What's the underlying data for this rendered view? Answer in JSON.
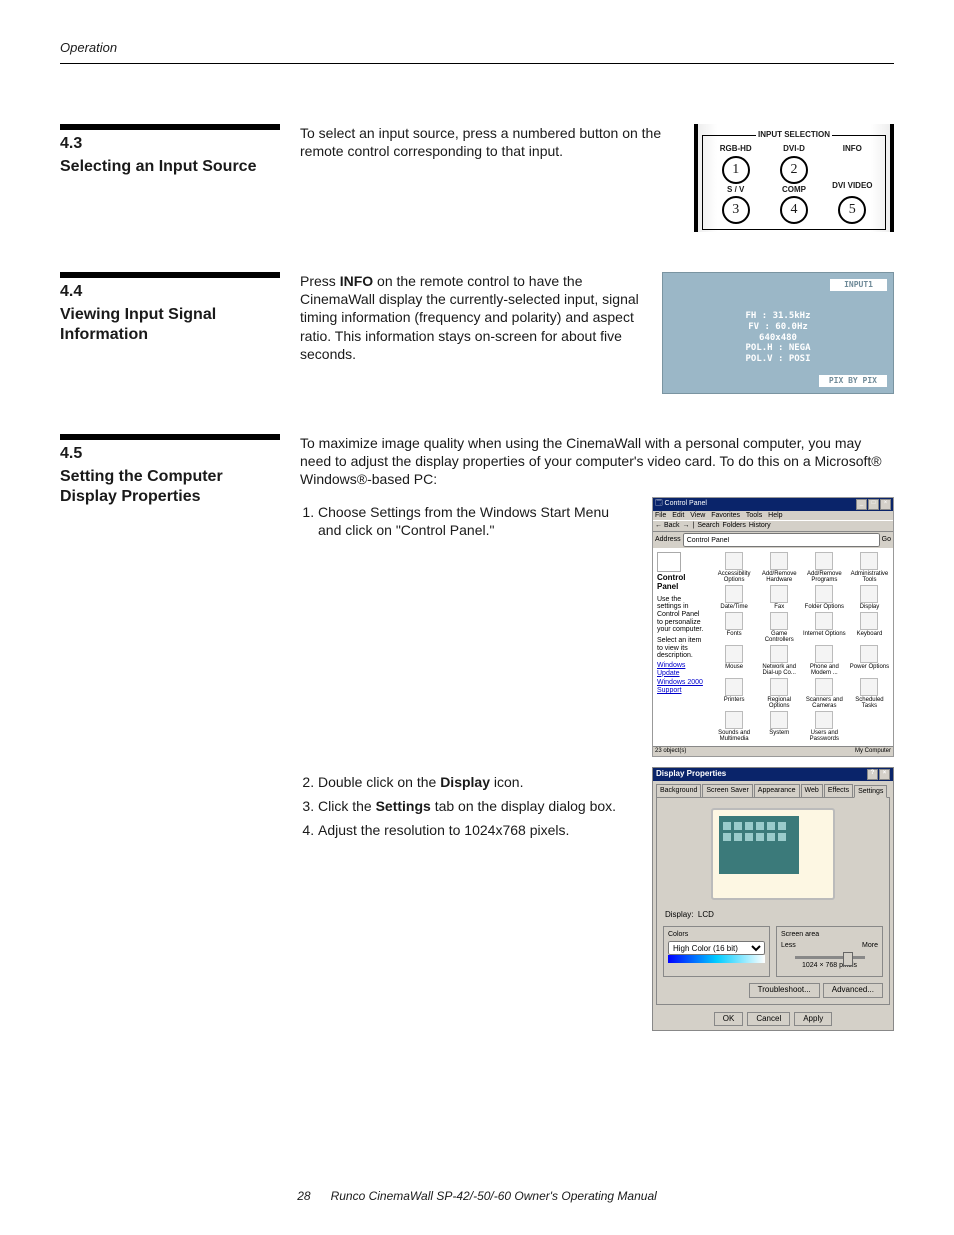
{
  "running_head": "Operation",
  "sections": {
    "s43": {
      "num": "4.3",
      "title": "Selecting an Input Source",
      "body": "To select an input source, press a numbered button on the remote control corresponding to that input."
    },
    "s44": {
      "num": "4.4",
      "title": "Viewing Input Signal Information",
      "body_pre": "Press ",
      "body_bold": "INFO",
      "body_post": " on the remote control to have the CinemaWall display the currently-selected input, signal timing information (frequency and polarity) and aspect ratio. This information stays on-screen for about five seconds."
    },
    "s45": {
      "num": "4.5",
      "title": "Setting the Computer Display Properties",
      "intro": "To maximize image quality when using the CinemaWall with a personal computer, you may need to adjust the display properties of your computer's video card. To do this on a Microsoft® Windows®-based PC:",
      "step1": "Choose Settings from the Windows Start Menu and click on \"Control Panel.\"",
      "step2_pre": "Double click on the ",
      "step2_bold": "Display",
      "step2_post": " icon.",
      "step3_pre": "Click the ",
      "step3_bold": "Settings",
      "step3_post": " tab on the display dialog box.",
      "step4": "Adjust the resolution to 1024x768 pixels."
    }
  },
  "remote": {
    "legend": "INPUT SELECTION",
    "cells": {
      "rgb": "RGB-HD",
      "dvi": "DVI-D",
      "info": "INFO",
      "sv": "S / V",
      "comp": "COMP",
      "dvivid": "DVI VIDEO",
      "b1": "1",
      "b2": "2",
      "b3": "3",
      "b4": "4",
      "b5": "5"
    }
  },
  "osd": {
    "input": "INPUT1",
    "l1": "FH : 31.5kHz",
    "l2": "FV : 60.0Hz",
    "l3": "640x480",
    "l4": "POL.H : NEGA",
    "l5": "POL.V : POSI",
    "bottom": "PIX BY PIX"
  },
  "cp": {
    "title": "Control Panel",
    "menu": [
      "File",
      "Edit",
      "View",
      "Favorites",
      "Tools",
      "Help"
    ],
    "tool": [
      "← Back",
      "→",
      "Search",
      "Folders",
      "History"
    ],
    "addr_label": "Address",
    "addr_val": "Control Panel",
    "go": "Go",
    "left_title": "Control Panel",
    "left_txt": "Use the settings in Control Panel to personalize your computer.",
    "left_txt2": "Select an item to view its description.",
    "links": [
      "Windows Update",
      "Windows 2000 Support"
    ],
    "icons": [
      "Accessibility Options",
      "Add/Remove Hardware",
      "Add/Remove Programs",
      "Administrative Tools",
      "Date/Time",
      "Fax",
      "Folder Options",
      "Display",
      "Fonts",
      "Game Controllers",
      "Internet Options",
      "Keyboard",
      "Mouse",
      "Network and Dial-up Co...",
      "Phone and Modem ...",
      "Power Options",
      "Printers",
      "Regional Options",
      "Scanners and Cameras",
      "Scheduled Tasks",
      "Sounds and Multimedia",
      "System",
      "Users and Passwords"
    ],
    "status_l": "23 object(s)",
    "status_r": "My Computer"
  },
  "dp": {
    "title": "Display Properties",
    "tabs": [
      "Background",
      "Screen Saver",
      "Appearance",
      "Web",
      "Effects",
      "Settings"
    ],
    "disp_label": "Display:",
    "disp_val": "LCD",
    "colors_lg": "Colors",
    "colors_val": "High Color (16 bit)",
    "area_lg": "Screen area",
    "less": "Less",
    "more": "More",
    "res": "1024 × 768 pixels",
    "troubleshoot": "Troubleshoot...",
    "advanced": "Advanced...",
    "ok": "OK",
    "cancel": "Cancel",
    "apply": "Apply"
  },
  "footer": {
    "page": "28",
    "title": "Runco CinemaWall SP-42/-50/-60 Owner's Operating Manual"
  }
}
